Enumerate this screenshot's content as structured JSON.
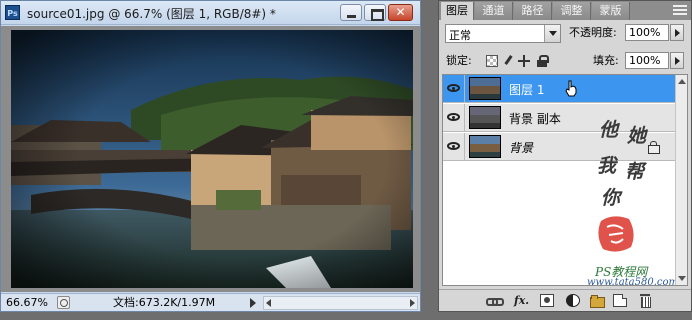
{
  "document": {
    "app_logo": "Ps",
    "title": "source01.jpg @ 66.7% (图层 1, RGB/8#) *",
    "close_glyph": "✕",
    "status": {
      "zoom": "66.67%",
      "doc_size": "文档:673.2K/1.97M"
    },
    "image_description_icon": "photo-icon"
  },
  "panel": {
    "tabs": [
      "图层",
      "通道",
      "路径",
      "调整",
      "蒙版"
    ],
    "active_tab": 0,
    "blend_mode": "正常",
    "opacity_label": "不透明度:",
    "opacity_value": "100%",
    "lock_label": "锁定:",
    "fill_label": "填充:",
    "fill_value": "100%",
    "layers": [
      {
        "name": "图层 1",
        "selected": true,
        "visible": true
      },
      {
        "name": "背景 副本",
        "selected": false,
        "visible": true
      },
      {
        "name": "背景",
        "selected": false,
        "visible": true,
        "locked": true
      }
    ],
    "watermark": {
      "chars": [
        "他",
        "她",
        "我",
        "帮",
        "你"
      ],
      "brand": "PS教程网",
      "url": "www.tata580.com"
    },
    "colors": {
      "selected_row": "#3c96f0",
      "panel_bg": "#d6d6d6"
    }
  }
}
